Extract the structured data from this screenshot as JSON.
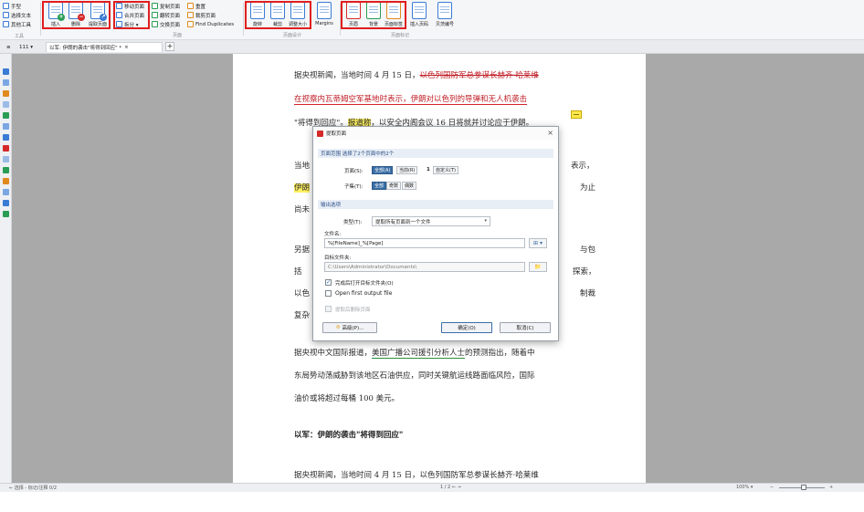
{
  "ribbon": {
    "left_tools": [
      "手型",
      "选择文本",
      "其他工具"
    ],
    "group1_label": "工具",
    "insert_label": "插入",
    "delete_label": "删除",
    "extract_label": "提取页面",
    "page_ops": [
      "移动页面",
      "合并页面",
      "拆分 ▾"
    ],
    "page_ops2": [
      "复制页面",
      "翻转页面",
      "交换页面"
    ],
    "page_ops3": [
      "重置",
      "裁剪页面",
      "Find Duplicates"
    ],
    "pages_group_label": "页面",
    "rotate_label": "旋转",
    "crop_label": "裁剪",
    "resize_label": "调整大小",
    "margins_label": "Margins",
    "page_design_group_label": "页面设计",
    "header_label": "页眉",
    "background_label": "背景",
    "watermark_label": "页面标签",
    "bates_label": "贝茨编号",
    "page_number_label": "插入页码",
    "page_mark_group_label": "页面标记"
  },
  "tabbar": {
    "menu": "≡",
    "tab_count": "111 ▾",
    "doc_tab_label": "以军: 伊朗的袭击\"将得到回应\" *",
    "close_mark": "×",
    "add_tab": "+"
  },
  "document": {
    "line1_pre": "据央视新闻，当地时间 4 月 15 日，",
    "line1_strike": "以色列国防军总参谋长赫齐·哈莱维",
    "line2_pre": "在视察内瓦蒂姆空军基地时表示，",
    "line2_ul": "伊朗对以色列的导弹和无人机袭击",
    "line3_pre": "\"将得到回应\"。",
    "line3_hl": "报道称",
    "line3_post": "，以安全内阁会议 16 日将就并讨论应于伊朗。",
    "line4_start": "当地",
    "line4_end": "表示，",
    "line5_start": "伊朗",
    "line5_end": "为止",
    "line6_start": "尚未",
    "line7_start": "另据",
    "line7_end": "与包",
    "line8_start": "括",
    "line8_end": "探索，",
    "line9_start": "以色",
    "line9_end": "制裁",
    "line10_start": "复杂",
    "para2_line1_pre": "据央视中文国际报道，",
    "para2_line1_ul": "美国广播公司援引分析人士",
    "para2_line1_post": "的预测指出，随着中",
    "para2_line2": "东局势动荡威胁到该地区石油供应，同时关键航运线路面临风险，国际",
    "para2_line3": "油价或将超过每桶 100 美元。",
    "heading": "以军：伊朗的袭击\"将得到回应\"",
    "repeat_line": "据央视新闻，当地时间 4 月 15 日，以色列国防军总参谋长赫齐·哈莱维"
  },
  "dialog": {
    "title": "提取页面",
    "close": "×",
    "range_section": "页面范围  选择了2个页面中的2个",
    "page_label": "页面(S):",
    "page_options": [
      "全部(A)",
      "当前(R)"
    ],
    "current_num": "1",
    "current_suffix": "自定义(T)",
    "subset_label": "子集(T):",
    "subset_options": [
      "全部",
      "奇数",
      "偶数"
    ],
    "output_section": "输出选项",
    "type_label": "类型(T):",
    "type_value": "提取所有页面到一个文件",
    "filename_label": "文件名:",
    "filename_value": "%[FileName]_%[Page]",
    "target_label": "目标文件夹:",
    "target_value": "C:\\Users\\Administrator\\Documents\\",
    "open_folder_label": "完成后打开目标文件夹(O)",
    "open_first_label": "Open first output file",
    "delete_after_label": "提取后删除页面",
    "settings_btn": "高级(P)...",
    "ok_btn": "确定(O)",
    "cancel_btn": "取消(C)"
  },
  "statusbar": {
    "left": "← 选择 - 标记/注释   0/2",
    "center": "1 / 2   ← →",
    "zoom": "100% ▾",
    "zoom_minus": "−",
    "zoom_plus": "+"
  },
  "colors": {
    "highlight_frame": "#e01e1e",
    "accent": "#3a6ea5",
    "canvas": "#a9a9a9"
  }
}
